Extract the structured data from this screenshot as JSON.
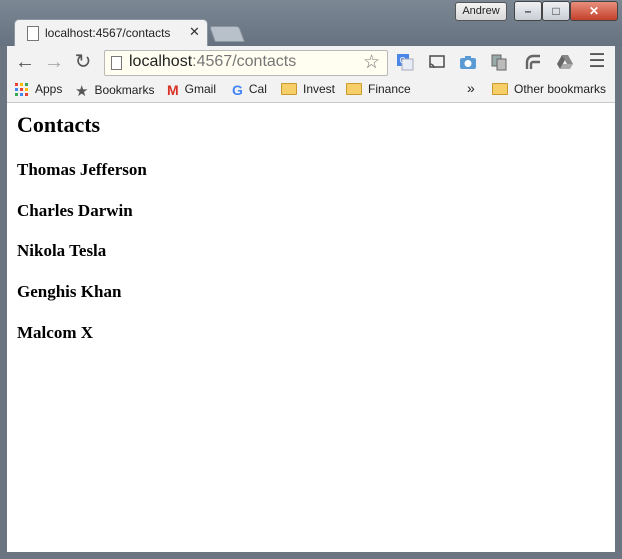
{
  "browser": {
    "profile_name": "Andrew",
    "tab_title": "localhost:4567/contacts",
    "url_host": "localhost",
    "url_path": ":4567/contacts",
    "bookmarks": [
      {
        "label": "Apps",
        "icon": "apps-grid-icon"
      },
      {
        "label": "Bookmarks",
        "icon": "star-icon"
      },
      {
        "label": "Gmail",
        "icon": "gmail-icon"
      },
      {
        "label": "Cal",
        "icon": "google-icon"
      },
      {
        "label": "Invest",
        "icon": "folder-icon"
      },
      {
        "label": "Finance",
        "icon": "folder-icon"
      }
    ],
    "overflow": "»",
    "other_bookmarks": "Other bookmarks"
  },
  "page": {
    "heading": "Contacts",
    "contacts": [
      "Thomas Jefferson",
      "Charles Darwin",
      "Nikola Tesla",
      "Genghis Khan",
      "Malcom X"
    ]
  },
  "colors": {
    "window_frame": "#6a7581",
    "close_button": "#c4412b",
    "folder": "#f6cf68"
  }
}
